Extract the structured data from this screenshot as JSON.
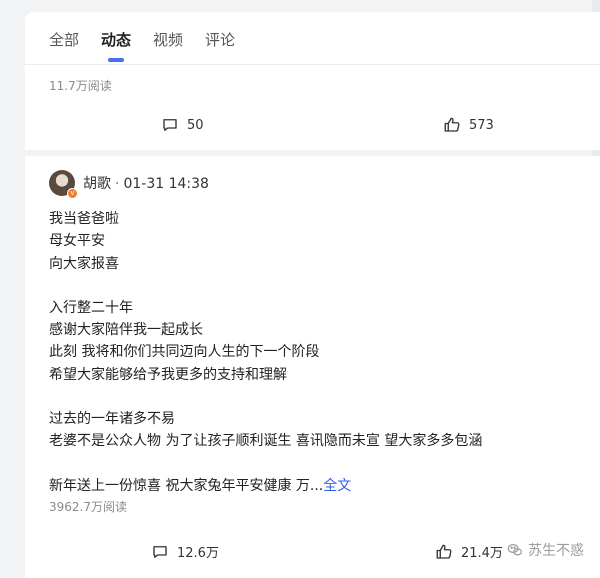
{
  "tabs": [
    {
      "label": "全部",
      "active": false
    },
    {
      "label": "动态",
      "active": true
    },
    {
      "label": "视频",
      "active": false
    },
    {
      "label": "评论",
      "active": false
    }
  ],
  "prev_post": {
    "read_count": "11.7万阅读",
    "comments": "50",
    "likes": "573"
  },
  "post": {
    "author": "胡歌",
    "date": "01-31 14:38",
    "paragraphs": [
      [
        "我当爸爸啦",
        "母女平安",
        "向大家报喜"
      ],
      [
        "入行整二十年",
        "感谢大家陪伴我一起成长",
        "此刻 我将和你们共同迈向人生的下一个阶段",
        "希望大家能够给予我更多的支持和理解"
      ],
      [
        "过去的一年诸多不易",
        "老婆不是公众人物 为了让孩子顺利诞生 喜讯隐而未宣 望大家多多包涵"
      ]
    ],
    "last_line": "新年送上一份惊喜 祝大家兔年平安健康 万...",
    "more_label": "全文",
    "read_count": "3962.7万阅读",
    "comments": "12.6万",
    "likes": "21.4万"
  },
  "watermark": "苏生不惑",
  "icons": {
    "comment": "comment-bubble-icon",
    "like": "thumbs-up-icon",
    "verified": "verified-badge-icon",
    "wechat": "wechat-icon"
  },
  "colors": {
    "accent": "#4b6cf5",
    "link": "#2f5cf0",
    "badge": "#f07c2c"
  }
}
